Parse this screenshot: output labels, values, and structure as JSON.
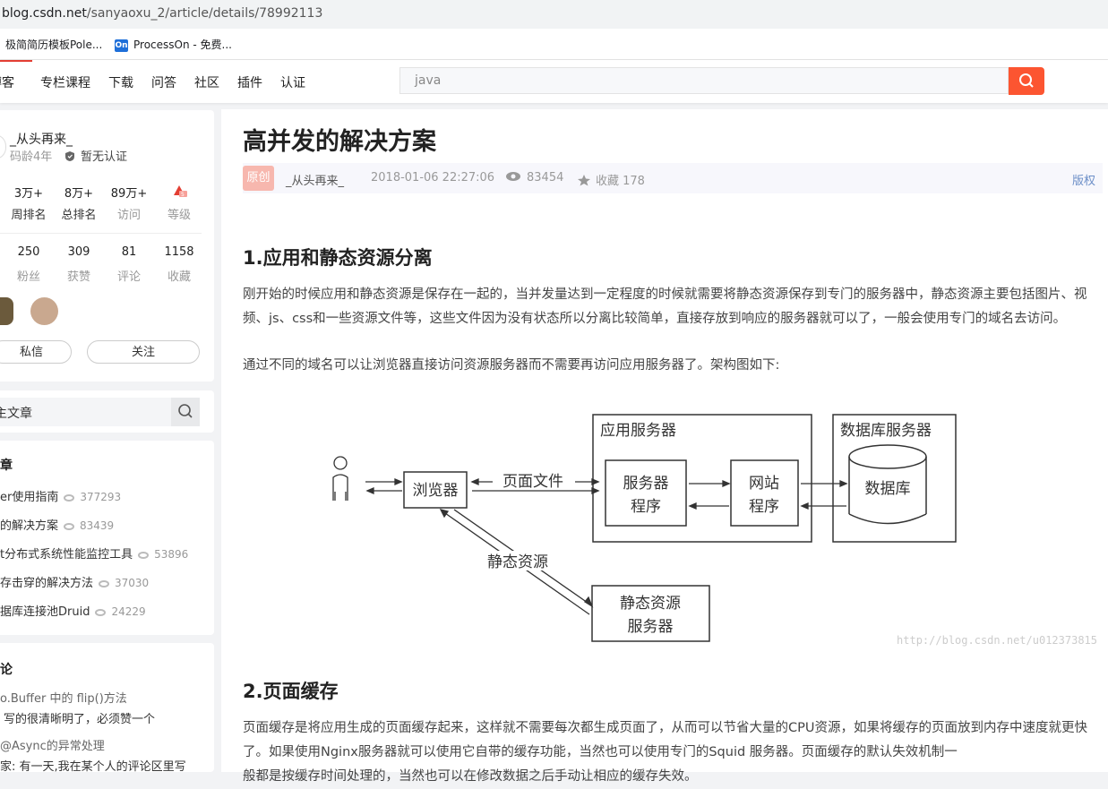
{
  "browser": {
    "url_domain": "blog.csdn.net",
    "url_path": "/sanyaoxu_2/article/details/78992113",
    "bookmarks": [
      {
        "label": "极简简历模板Pole...",
        "icon": "document-icon"
      },
      {
        "label": "ProcessOn - 免费...",
        "icon_text": "On"
      }
    ]
  },
  "nav": {
    "tabs": [
      "博客",
      "专栏课程",
      "下载",
      "问答",
      "社区",
      "插件",
      "认证"
    ],
    "search_placeholder": "java",
    "accent": "#fc5531"
  },
  "profile": {
    "name": "_从头再来_",
    "code_age": "码龄4年",
    "cert": "暂无认证",
    "stats_row1": [
      {
        "value": "3万+",
        "label": "周排名"
      },
      {
        "value": "8万+",
        "label": "总排名"
      },
      {
        "value": "89万+",
        "label": "访问"
      },
      {
        "value": "",
        "label": "等级"
      }
    ],
    "stats_row2": [
      {
        "value": "250",
        "label": "粉丝"
      },
      {
        "value": "309",
        "label": "获赞"
      },
      {
        "value": "81",
        "label": "评论"
      },
      {
        "value": "1158",
        "label": "收藏"
      }
    ],
    "btn_message": "私信",
    "btn_follow": "关注"
  },
  "side_search": {
    "placeholder": "主文章"
  },
  "hot": {
    "title": "章",
    "items": [
      {
        "title": "er使用指南",
        "count": "377293"
      },
      {
        "title": "的解决方案",
        "count": "83439"
      },
      {
        "title": "t分布式系统性能监控工具",
        "count": "53896"
      },
      {
        "title": "存击穿的解决方法",
        "count": "37030"
      },
      {
        "title": "据库连接池Druid",
        "count": "24229"
      }
    ]
  },
  "comments": {
    "title": "论",
    "items": [
      {
        "article": "o.Buffer 中的 flip()方法",
        "text": "写的很清晰明了，必须赞一个"
      },
      {
        "article": "@Async的异常处理",
        "text": "家: 有一天,我在某个人的评论区里写"
      }
    ]
  },
  "article": {
    "title": "高并发的解决方案",
    "badge": "原创",
    "author": "_从头再来_",
    "datetime": "2018-01-06 22:27:06",
    "views": "83454",
    "favorites": "收藏 178",
    "copyright": "版权",
    "section1_title": "1.应用和静态资源分离",
    "section1_p1": "刚开始的时候应用和静态资源是保存在一起的，当并发量达到一定程度的时候就需要将静态资源保存到专门的服务器中，静态资源主要包括图片、视频、js、css和一些资源文件等，这些文件因为没有状态所以分离比较简单，直接存放到响应的服务器就可以了，一般会使用专门的域名去访问。",
    "section1_p2": "通过不同的域名可以让浏览器直接访问资源服务器而不需要再访问应用服务器了。架构图如下:",
    "section2_title": "2.页面缓存",
    "section2_p1": "页面缓存是将应用生成的页面缓存起来，这样就不需要每次都生成页面了，从而可以节省大量的CPU资源，如果将缓存的页面放到内存中速度就更快了。如果使用Nginx服务器就可以使用它自带的缓存功能，当然也可以使用专门的Squid 服务器。页面缓存的默认失效机制一",
    "section2_p1_cut": "般都是按缓存时间处理的，当然也可以在修改数据之后手动让相应的缓存失效。"
  },
  "diagram": {
    "app_server": "应用服务器",
    "db_server": "数据库服务器",
    "browser": "浏览器",
    "page_file": "页面文件",
    "server_program_1": "服务器",
    "server_program_2": "程序",
    "web_1": "网站",
    "web_2": "程序",
    "database": "数据库",
    "static_resource": "静态资源",
    "static_server_1": "静态资源",
    "static_server_2": "服务器",
    "watermark": "http://blog.csdn.net/u012373815"
  }
}
